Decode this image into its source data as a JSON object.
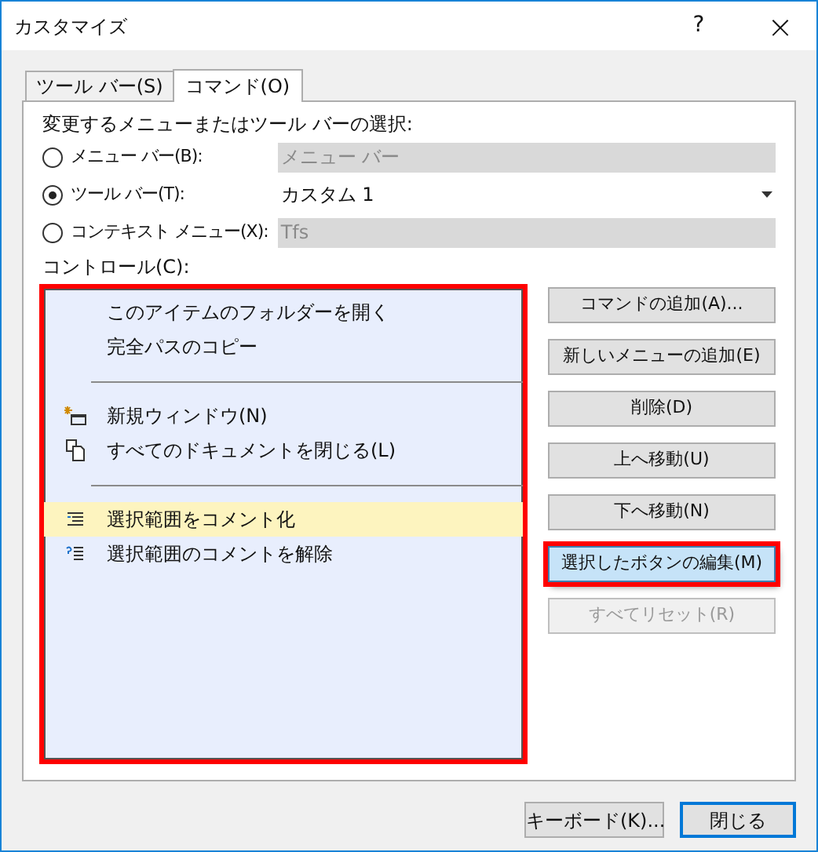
{
  "window": {
    "title": "カスタマイズ",
    "help": "?",
    "close": "×"
  },
  "tabs": [
    {
      "label": "ツール バー(S)",
      "selected": false
    },
    {
      "label": "コマンド(O)",
      "selected": true
    }
  ],
  "choice_label": "変更するメニューまたはツール バーの選択:",
  "choices": [
    {
      "label": "メニュー バー(B):",
      "selected": false,
      "value": "メニュー バー",
      "disabled": true,
      "dropdown": false
    },
    {
      "label": "ツール バー(T):",
      "selected": true,
      "value": "カスタム 1",
      "disabled": false,
      "dropdown": true
    },
    {
      "label": "コンテキスト メニュー(X):",
      "selected": false,
      "value": "Tfs",
      "disabled": true,
      "dropdown": false
    }
  ],
  "controls_label": "コントロール(C):",
  "controls": {
    "highlighted": true,
    "items": [
      {
        "kind": "command",
        "label": "このアイテムのフォルダーを開く",
        "selected": false
      },
      {
        "kind": "command",
        "label": "完全パスのコピー",
        "selected": false
      },
      {
        "kind": "separator"
      },
      {
        "kind": "command",
        "label": "新規ウィンドウ(N)",
        "selected": false
      },
      {
        "kind": "command",
        "label": "すべてのドキュメントを閉じる(L)",
        "selected": false
      },
      {
        "kind": "separator"
      },
      {
        "kind": "command",
        "label": "選択範囲をコメント化",
        "selected": true
      },
      {
        "kind": "command",
        "label": "選択範囲のコメントを解除",
        "selected": false
      }
    ]
  },
  "buttons": [
    {
      "label": "コマンドの追加(A)...",
      "disabled": false,
      "highlighted": false
    },
    {
      "label": "新しいメニューの追加(E)",
      "disabled": false,
      "highlighted": false
    },
    {
      "label": "削除(D)",
      "disabled": false,
      "highlighted": false
    },
    {
      "label": "上へ移動(U)",
      "disabled": false,
      "highlighted": false
    },
    {
      "label": "下へ移動(N)",
      "disabled": false,
      "highlighted": false
    },
    {
      "label": "選択したボタンの編集(M)",
      "disabled": false,
      "highlighted": true
    },
    {
      "label": "すべてリセット(R)",
      "disabled": true,
      "highlighted": false
    }
  ],
  "footer": [
    {
      "label": "キーボード(K)...",
      "default": false
    },
    {
      "label": "閉じる",
      "default": true
    }
  ]
}
